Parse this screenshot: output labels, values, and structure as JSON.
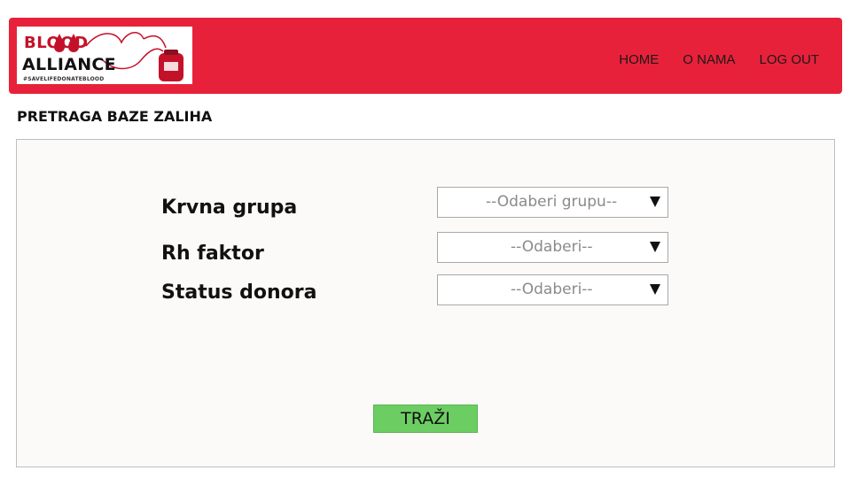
{
  "header": {
    "logo": {
      "line1": "BLOOD",
      "line2": "ALLIANCE",
      "tagline": "#SAVELIFEDONATEBLOOD"
    },
    "nav": [
      {
        "label": "HOME"
      },
      {
        "label": "O NAMA"
      },
      {
        "label": "LOG OUT"
      }
    ],
    "background_color": "#e8213a"
  },
  "page": {
    "title": "PRETRAGA BAZE ZALIHA"
  },
  "form": {
    "fields": [
      {
        "label": "Krvna grupa",
        "placeholder": "--Odaberi grupu--"
      },
      {
        "label": "Rh faktor",
        "placeholder": "--Odaberi--"
      },
      {
        "label": "Status donora",
        "placeholder": "--Odaberi--"
      }
    ],
    "submit_label": "TRAŽI",
    "submit_color": "#6ccd63"
  }
}
